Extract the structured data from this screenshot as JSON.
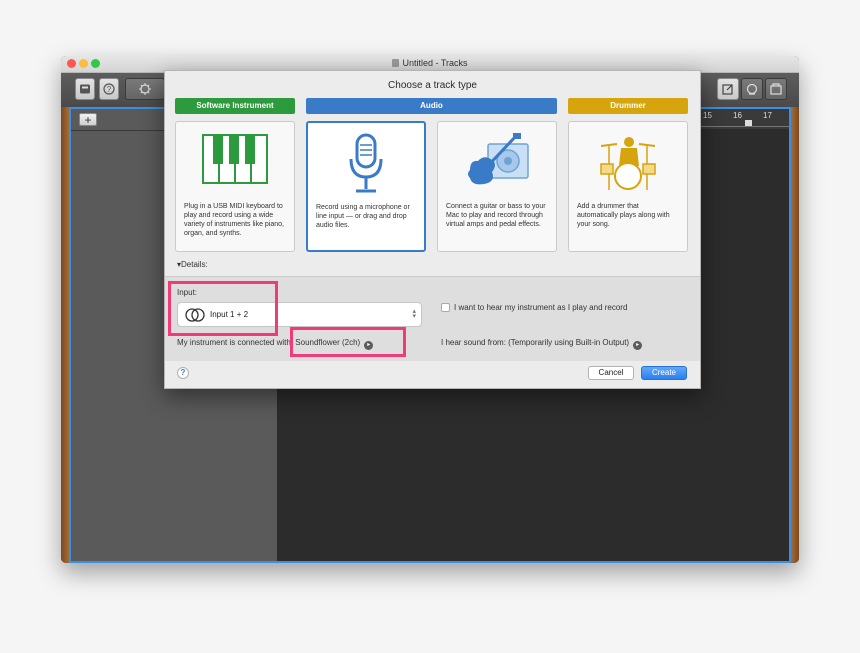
{
  "window": {
    "title": "Untitled - Tracks"
  },
  "colors": {
    "software": "#2e9a3e",
    "audio": "#3a7bc8",
    "drummer": "#d6a40c",
    "highlight": "#f23a7b"
  },
  "toolbar": {
    "icons": [
      "library-icon",
      "help-icon",
      "smart-controls-icon",
      "scissors-icon",
      "notepad-icon",
      "loop-icon",
      "media-browser-icon"
    ]
  },
  "tracks": {
    "add_label": "+",
    "ruler_marks": [
      "15",
      "16",
      "17"
    ]
  },
  "dialog": {
    "title": "Choose a track type",
    "categories": [
      {
        "label": "Software Instrument"
      },
      {
        "label": "Audio"
      },
      {
        "label": "Drummer"
      }
    ],
    "cards": [
      {
        "desc": "Plug in a USB MIDI keyboard to play and record using a wide variety of instruments like piano, organ, and synths."
      },
      {
        "desc": "Record using a microphone or line input — or drag and drop audio files."
      },
      {
        "desc": "Connect a guitar or bass to your Mac to play and record through virtual amps and pedal effects."
      },
      {
        "desc": "Add a drummer that automatically plays along with your song."
      }
    ],
    "details_label": "▾Details:",
    "input_label": "Input:",
    "input_value": "Input 1 + 2",
    "connected_prefix": "My instrument is connected with:",
    "connected_device": "Soundflower (2ch)",
    "monitor_label": "I want to hear my instrument as I play and record",
    "monitor_checked": false,
    "hear_from": "I hear sound from: (Temporarily using Built-in Output)",
    "help_label": "?",
    "cancel_label": "Cancel",
    "create_label": "Create"
  }
}
